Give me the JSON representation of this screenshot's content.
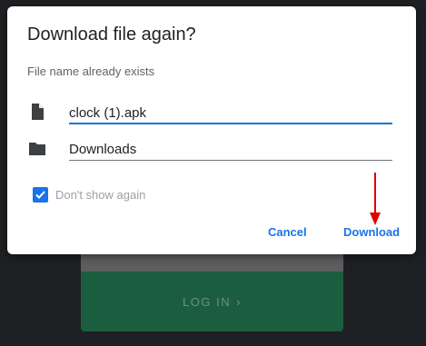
{
  "dialog": {
    "title": "Download file again?",
    "subtitle": "File name already exists",
    "file_name": "clock (1).apk",
    "folder": "Downloads",
    "checkbox_label": "Don't show again",
    "checkbox_checked": true,
    "cancel_label": "Cancel",
    "download_label": "Download"
  },
  "background": {
    "login_label": "LOG IN",
    "login_icon": "chevron-right-icon"
  },
  "colors": {
    "accent": "#1a73e8",
    "annotation_arrow": "#e00000",
    "login_button": "#1b5e3f"
  },
  "icons": {
    "file": "file-icon",
    "folder": "folder-icon",
    "check": "check-icon"
  }
}
